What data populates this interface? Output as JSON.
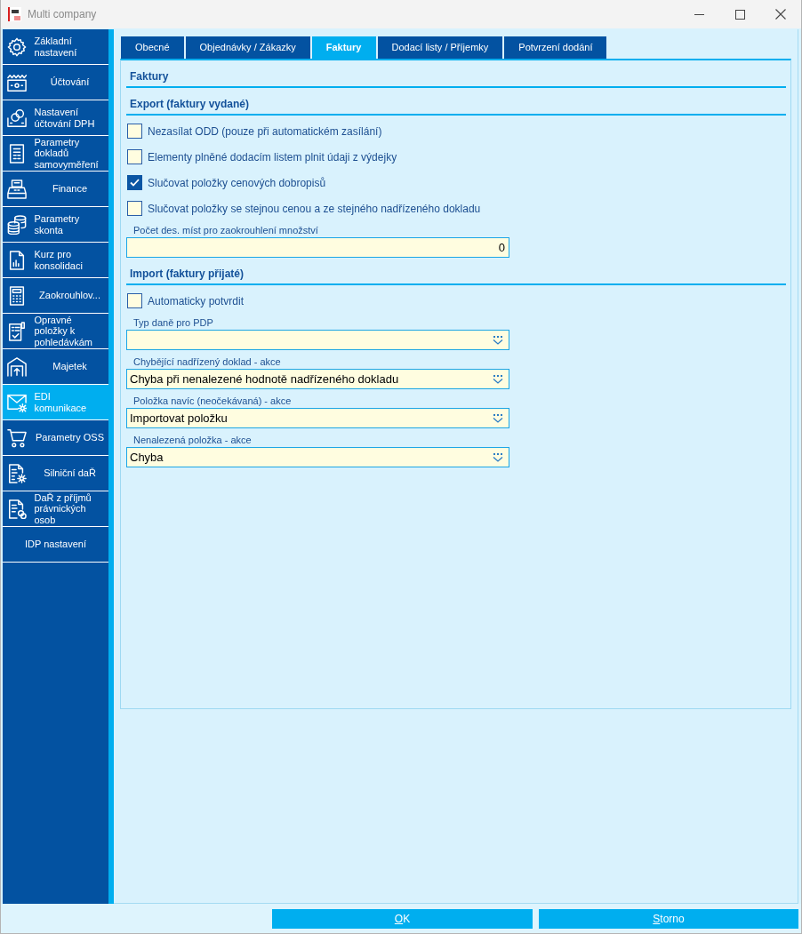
{
  "window": {
    "title": "Multi company"
  },
  "sidebar": {
    "items": [
      {
        "label": "Základní nastavení",
        "selected": false
      },
      {
        "label": "Účtování",
        "selected": false
      },
      {
        "label": "Nastavení účtování DPH",
        "selected": false
      },
      {
        "label": "Parametry dokladů samovyměření",
        "selected": false
      },
      {
        "label": "Finance",
        "selected": false
      },
      {
        "label": "Parametry skonta",
        "selected": false
      },
      {
        "label": "Kurz pro konsolidaci",
        "selected": false
      },
      {
        "label": "Zaokrouhlov...",
        "selected": false
      },
      {
        "label": "Opravné položky k pohledávkám",
        "selected": false
      },
      {
        "label": "Majetek",
        "selected": false
      },
      {
        "label": "EDI komunikace",
        "selected": true
      },
      {
        "label": "Parametry OSS",
        "selected": false
      },
      {
        "label": "Silniční daŘ",
        "selected": false
      },
      {
        "label": "DaŘ z příjmů právnických osob",
        "selected": false
      },
      {
        "label": "IDP nastavení",
        "selected": false
      }
    ]
  },
  "tabs": [
    {
      "label": "Obecné",
      "selected": false
    },
    {
      "label": "Objednávky / Zákazky",
      "selected": false
    },
    {
      "label": "Faktury",
      "selected": true
    },
    {
      "label": "Dodací listy / Příjemky",
      "selected": false
    },
    {
      "label": "Potvrzení dodání",
      "selected": false
    }
  ],
  "panel": {
    "title": "Faktury",
    "sections": [
      {
        "title": "Export (faktury vydané)",
        "fields": [
          {
            "kind": "checkbox",
            "label": "Nezasílat ODD (pouze při automatickém zasílání)",
            "checked": false
          },
          {
            "kind": "checkbox",
            "label": "Elementy plněné dodacím listem plnit údaji z výdejky",
            "checked": false
          },
          {
            "kind": "checkbox",
            "label": "Slučovat položky cenových dobropisů",
            "checked": true
          },
          {
            "kind": "checkbox",
            "label": "Slučovat položky se stejnou cenou a ze stejného nadřízeného dokladu",
            "checked": false
          },
          {
            "kind": "number",
            "label": "Počet des. míst pro zaokrouhlení množství",
            "value": "0"
          }
        ]
      },
      {
        "title": "Import (faktury přijaté)",
        "fields": [
          {
            "kind": "checkbox",
            "label": "Automaticky potvrdit",
            "checked": false
          },
          {
            "kind": "dropdown",
            "label": "Typ daně pro PDP"
          },
          {
            "kind": "dropdown",
            "label": "Chybějící nadřízený doklad - akce",
            "value": "Chyba při nenalezené hodnotě nadřízeného dokladu"
          },
          {
            "kind": "dropdown",
            "label": "Položka navíc (neočekávaná) - akce",
            "value": "Importovat položku"
          },
          {
            "kind": "dropdown",
            "label": "Nenalezená položka - akce",
            "value": "Chyba"
          }
        ]
      }
    ]
  },
  "buttons": [
    "OK",
    "Storno"
  ]
}
